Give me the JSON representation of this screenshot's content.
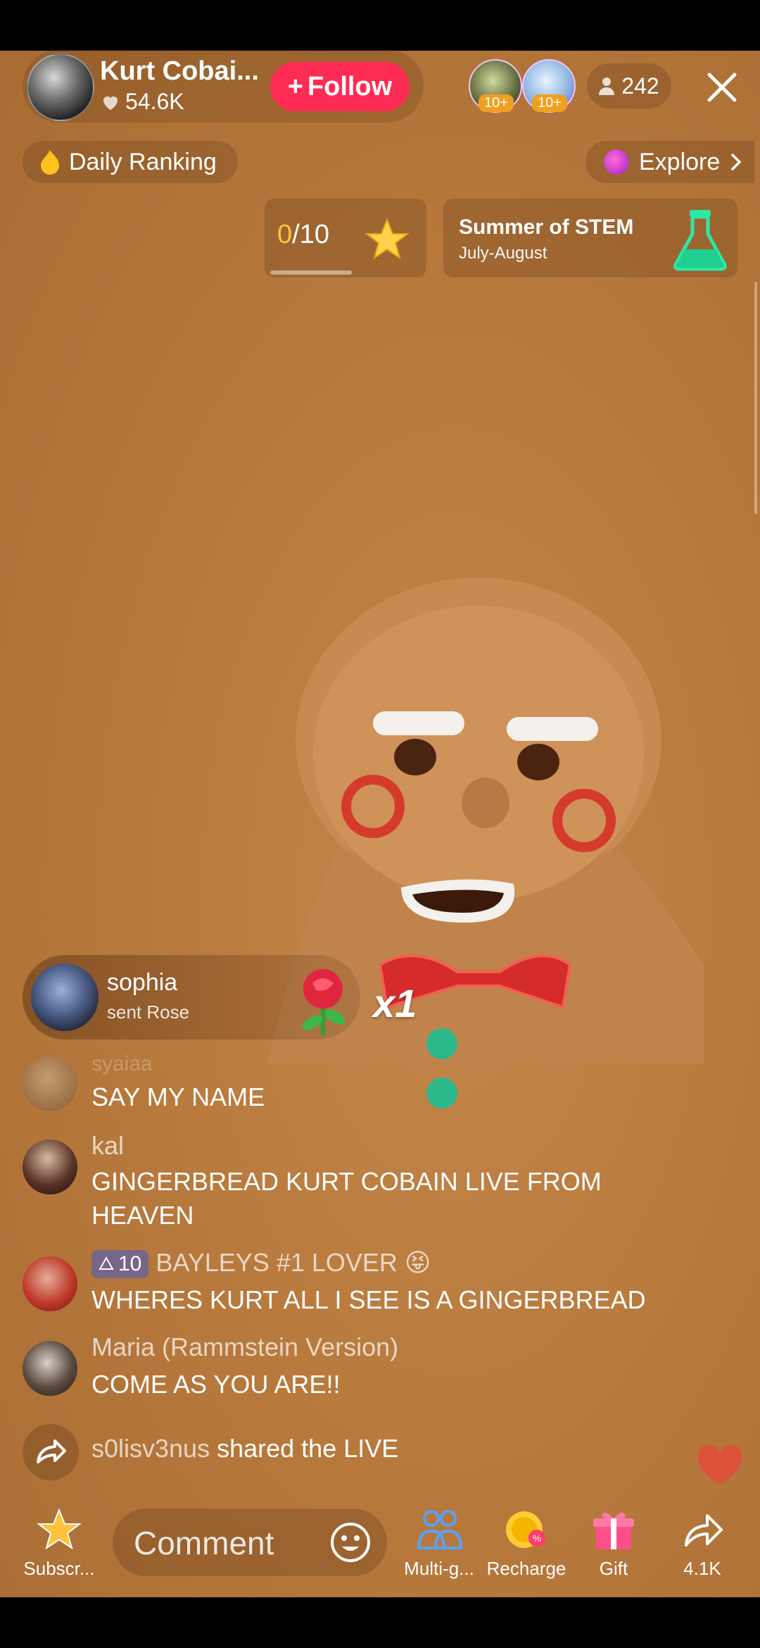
{
  "host": {
    "name": "Kurt Cobai...",
    "likes": "54.6K",
    "follow_label": "Follow",
    "viewer_badges": [
      "10+",
      "10+"
    ],
    "viewer_count": "242"
  },
  "banners": {
    "daily_ranking": "Daily Ranking",
    "explore": "Explore"
  },
  "goal": {
    "current": "0",
    "total": "/10",
    "progress": 0
  },
  "event": {
    "title": "Summer of STEM",
    "subtitle": "July-August"
  },
  "gift_toast": {
    "user": "sophia",
    "action": "sent Rose",
    "count": "x1"
  },
  "chat": [
    {
      "user": "syaiaa",
      "message": "SAY MY NAME",
      "faded_user": true
    },
    {
      "user": "kal",
      "message": "GINGERBREAD KURT COBAIN LIVE FROM HEAVEN"
    },
    {
      "user": "BAYLEYS #1 LOVER 😝",
      "level": "10",
      "message": "WHERES KURT ALL I SEE IS A GINGERBREAD"
    },
    {
      "user": "Maria (Rammstein Version)",
      "message": "COME AS YOU ARE!!"
    }
  ],
  "share_event": {
    "user": "s0lisv3nus",
    "text": " shared the LIVE"
  },
  "bottom_bar": {
    "subscribe": "Subscr...",
    "comment_placeholder": "Comment",
    "multi_guest": "Multi-g...",
    "recharge": "Recharge",
    "gift": "Gift",
    "share_count": "4.1K"
  },
  "colors": {
    "follow": "#fe2c55",
    "background": "#b97a3d",
    "accent_gold": "#ffc53d"
  }
}
